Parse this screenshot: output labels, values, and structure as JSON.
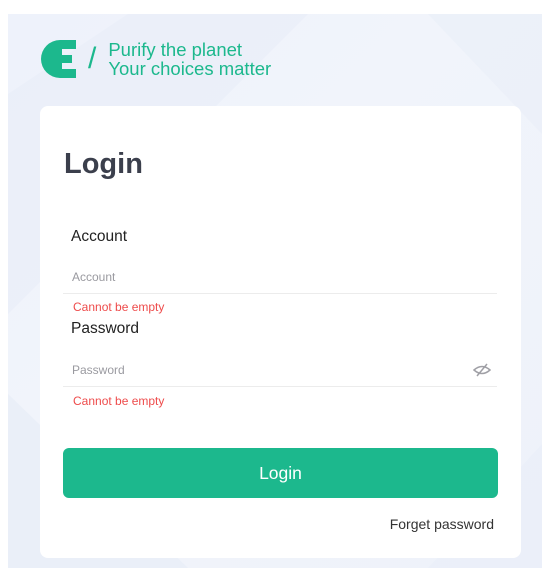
{
  "brand": {
    "tagline_line1": "Purify the planet",
    "tagline_line2": "Your choices matter",
    "slash": "/",
    "logo_icon": "e-logo-icon",
    "accent_color": "#1cb88d"
  },
  "form": {
    "title": "Login",
    "account": {
      "label": "Account",
      "placeholder": "Account",
      "value": "",
      "error": "Cannot be empty"
    },
    "password": {
      "label": "Password",
      "placeholder": "Password",
      "value": "",
      "error": "Cannot be empty",
      "toggle_icon": "eye-off-icon"
    },
    "submit_label": "Login",
    "forget_label": "Forget password"
  },
  "colors": {
    "error": "#ee4b4b",
    "title": "#3b3f4c"
  }
}
